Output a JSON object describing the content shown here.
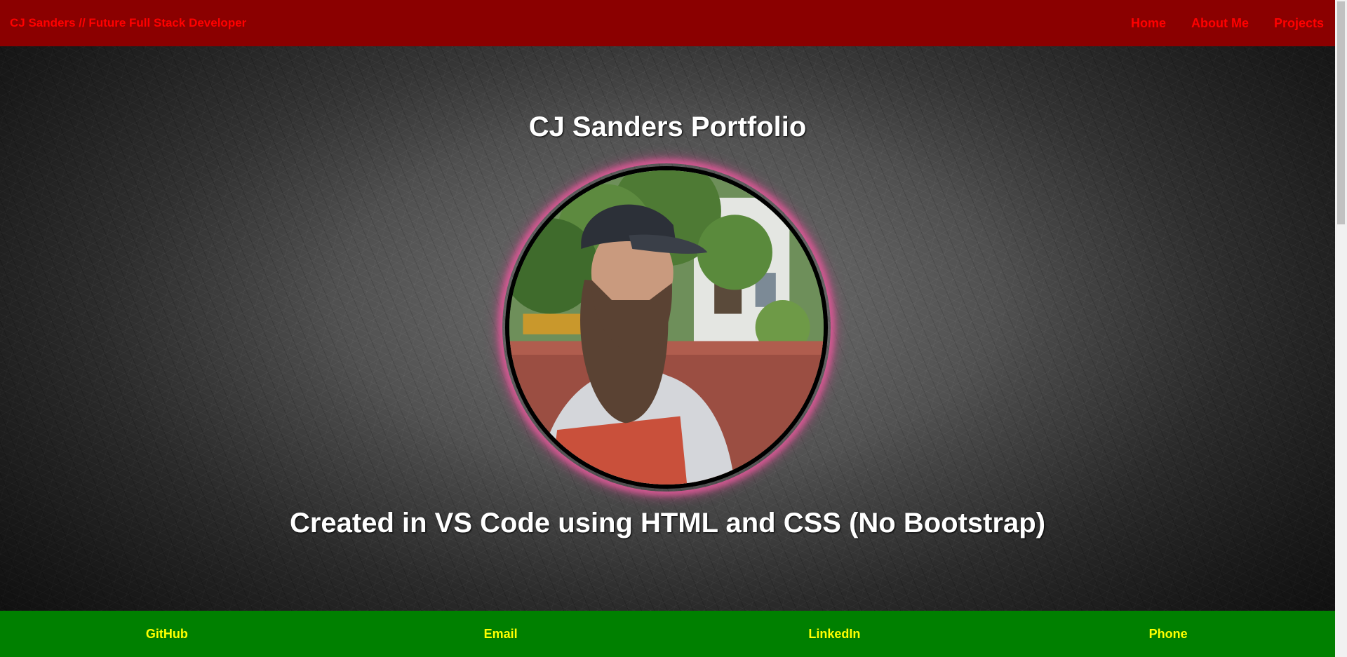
{
  "navbar": {
    "brand": "CJ Sanders // Future Full Stack Developer",
    "links": [
      "Home",
      "About Me",
      "Projects"
    ]
  },
  "hero": {
    "title": "CJ Sanders Portfolio",
    "subtitle": "Created in VS Code using HTML and CSS (No Bootstrap)"
  },
  "footer": {
    "links": [
      "GitHub",
      "Email",
      "LinkedIn",
      "Phone"
    ]
  },
  "colors": {
    "navbar_bg": "#8b0000",
    "navbar_text": "#ff0000",
    "footer_bg": "#008000",
    "footer_text": "#ffff00",
    "profile_glow": "#dc5a96"
  }
}
